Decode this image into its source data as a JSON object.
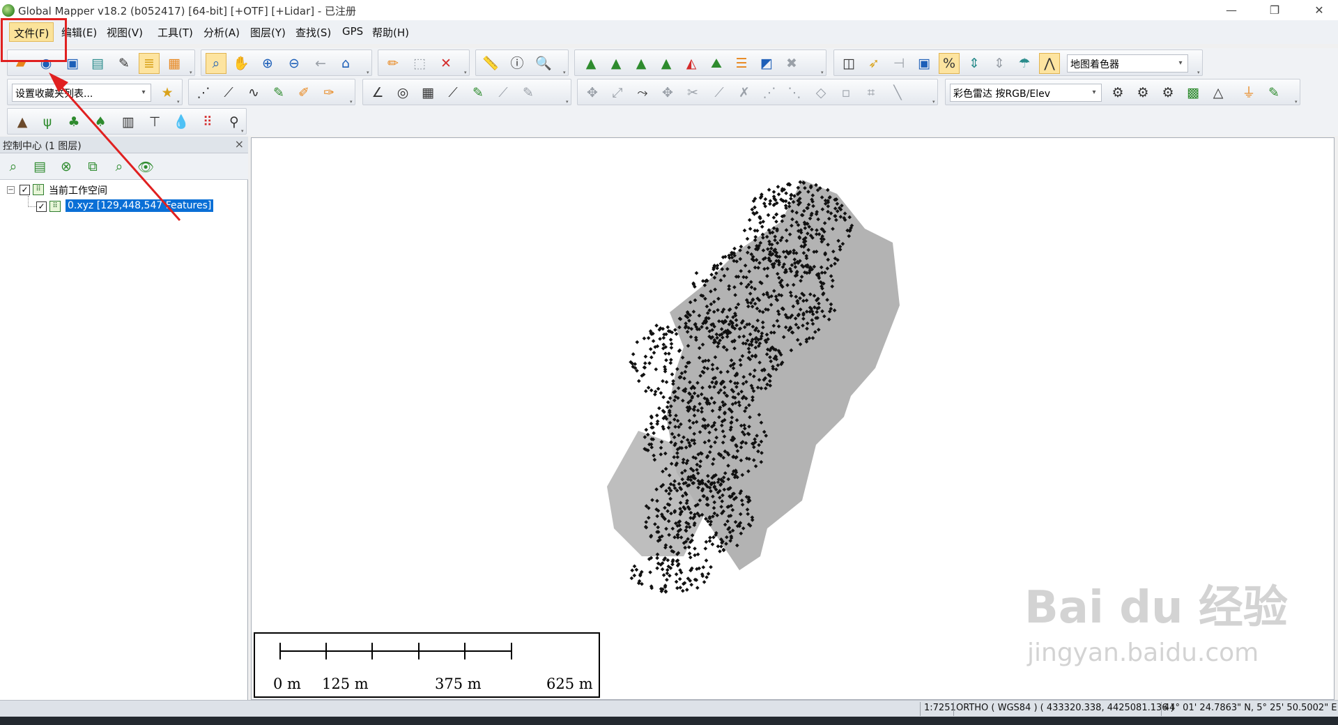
{
  "window": {
    "title": "Global Mapper v18.2 (b052417) [64-bit] [+OTF] [+Lidar] - 已注册",
    "minimize": "—",
    "restore": "❐",
    "close": "✕"
  },
  "menu": {
    "items": [
      {
        "label": "文件(F)"
      },
      {
        "label": "编辑(E)"
      },
      {
        "label": "视图(V)"
      },
      {
        "label": "工具(T)"
      },
      {
        "label": "分析(A)"
      },
      {
        "label": "图层(Y)"
      },
      {
        "label": "查找(S)"
      },
      {
        "label": "GPS"
      },
      {
        "label": "帮助(H)"
      }
    ]
  },
  "toolbar": {
    "shader_combo": "地图着色器",
    "favorites_combo": "设置收藏夹列表...",
    "lidar_color_combo": "彩色雷达 按RGB/Elev"
  },
  "control_center": {
    "title": "控制中心 (1 图层)",
    "close": "×",
    "workspace_label": "当前工作空间",
    "layer_label": "0.xyz [129,448,547 Features]"
  },
  "scalebar": {
    "labels": [
      "0 m",
      "125 m",
      "375 m",
      "625 m"
    ]
  },
  "status": {
    "scale": "1:7251",
    "projection": "ORTHO ( WGS84 ) ( 433320.338, 4425081.136 )",
    "latlon": "44° 01' 24.7863\" N, 5° 25' 50.5002\" E"
  },
  "watermark": {
    "brand": "Bai du 经验",
    "url": "jingyan.baidu.com"
  },
  "annotation_color": "#e02020",
  "highlight_color": "#fbe39a",
  "selection_color": "#0a6fd6"
}
